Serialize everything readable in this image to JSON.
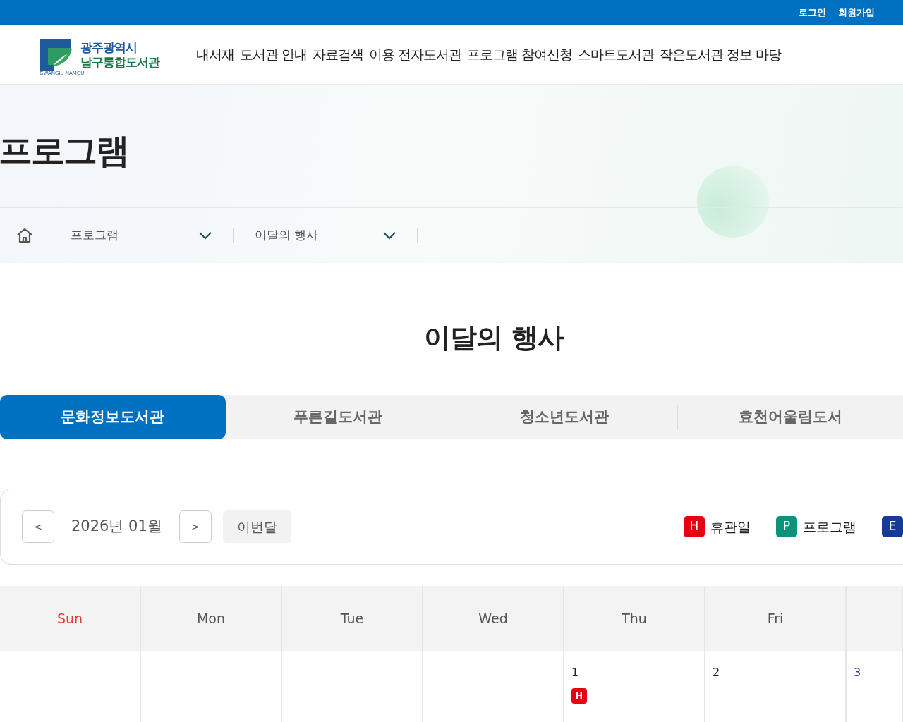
{
  "top_bar": {
    "links": [
      "로그인",
      "회원가입"
    ]
  },
  "logo": {
    "line_1": "광주광역시",
    "line_2": "남구통합도서관",
    "mark_text": "GWANGJU NAMGU"
  },
  "menu": [
    "내서재",
    "도서관 안내",
    "자료검색",
    "이용 전자도서관",
    "프로그램 참여신청",
    "스마트도서관",
    "작은도서관 정보 마당"
  ],
  "banner": {
    "title": "프로그램"
  },
  "breadcrumb": [
    "프로그램",
    "이달의 행사"
  ],
  "page_title": "이달의 행사",
  "tabs": [
    {
      "label": "문화정보도서관",
      "selected": true
    },
    {
      "label": "푸른길도서관",
      "selected": false
    },
    {
      "label": "청소년도서관",
      "selected": false
    },
    {
      "label": "효천어울림도서",
      "selected": false
    }
  ],
  "calendar_nav": {
    "prev": "<",
    "month": "2026년 01월",
    "next": ">",
    "today": "이번달"
  },
  "legend": [
    {
      "code": "H",
      "label": "휴관일",
      "color": "#e60012"
    },
    {
      "code": "P",
      "label": "프로그램",
      "color": "#0e937b"
    },
    {
      "code": "E",
      "color": "#163a95"
    }
  ],
  "weekdays": [
    {
      "label": "Sun",
      "kind": "sun"
    },
    {
      "label": "Mon",
      "kind": "weekday"
    },
    {
      "label": "Tue",
      "kind": "weekday"
    },
    {
      "label": "Wed",
      "kind": "weekday"
    },
    {
      "label": "Thu",
      "kind": "weekday"
    },
    {
      "label": "Fri",
      "kind": "weekday"
    },
    {
      "kind": "sat"
    }
  ],
  "days": [
    {
      "kind": "blank"
    },
    {
      "kind": "blank"
    },
    {
      "kind": "blank"
    },
    {
      "kind": "blank"
    },
    {
      "day": "1",
      "kind": "weekday",
      "events": [
        {
          "code": "H",
          "color": "#e60012"
        }
      ]
    },
    {
      "day": "2",
      "kind": "weekday"
    },
    {
      "day": "3",
      "kind": "sat"
    }
  ]
}
